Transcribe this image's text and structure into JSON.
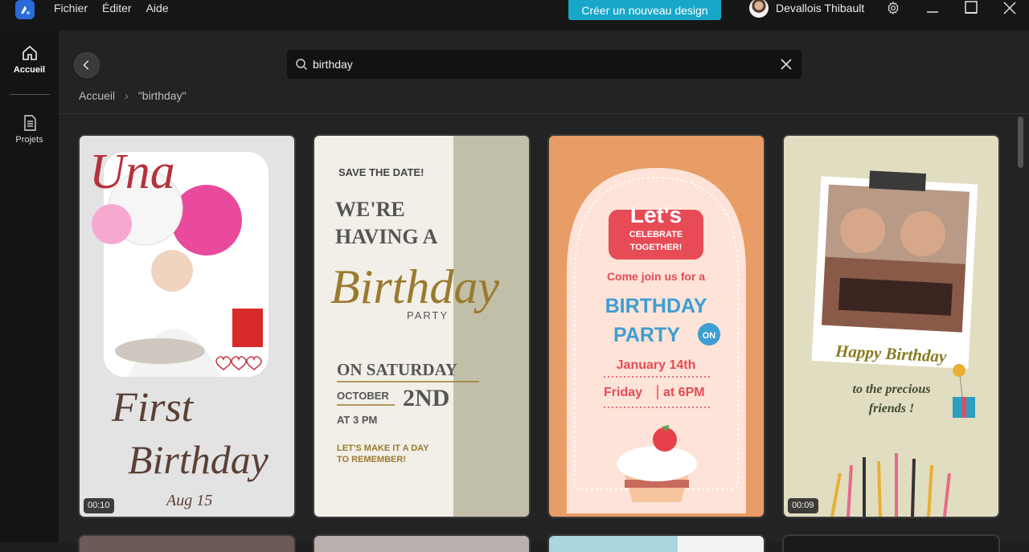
{
  "menu": {
    "items": [
      "Fichier",
      "Éditer",
      "Aide"
    ]
  },
  "header": {
    "create_label": "Créer un nouveau design",
    "user_name": "Devallois Thibault"
  },
  "rail": {
    "items": [
      {
        "label": "Accueil",
        "icon": "home-icon"
      },
      {
        "label": "Projets",
        "icon": "document-icon"
      }
    ]
  },
  "search": {
    "value": "birthday",
    "placeholder": ""
  },
  "breadcrumb": {
    "home": "Accueil",
    "current": "\"birthday\""
  },
  "templates": [
    {
      "duration": "00:10",
      "texts": {
        "name": "Una",
        "line1": "First",
        "line2": "Birthday",
        "date": "Aug 15"
      }
    },
    {
      "duration": "",
      "texts": {
        "l1": "SAVE THE DATE!",
        "l2": "WE'RE",
        "l3": "HAVING A",
        "l4": "Birthday",
        "l5": "PARTY",
        "l6": "ON SATURDAY",
        "l7": "OCTOBER",
        "l8": "2ND",
        "l9": "AT 3 PM",
        "l10": "LET'S MAKE IT A DAY",
        "l11": "TO REMEMBER!"
      }
    },
    {
      "duration": "",
      "texts": {
        "l1": "Let's",
        "l2": "CELEBRATE",
        "l3": "TOGETHER!",
        "l4": "Come join us for a",
        "l5": "BIRTHDAY",
        "l6": "PARTY",
        "l7": "ON",
        "l8": "January 14th",
        "l9": "Friday",
        "l10": "at 6PM"
      }
    },
    {
      "duration": "00:09",
      "texts": {
        "l1": "Happy Birthday",
        "l2": "to the precious",
        "l3": "friends !"
      }
    }
  ]
}
